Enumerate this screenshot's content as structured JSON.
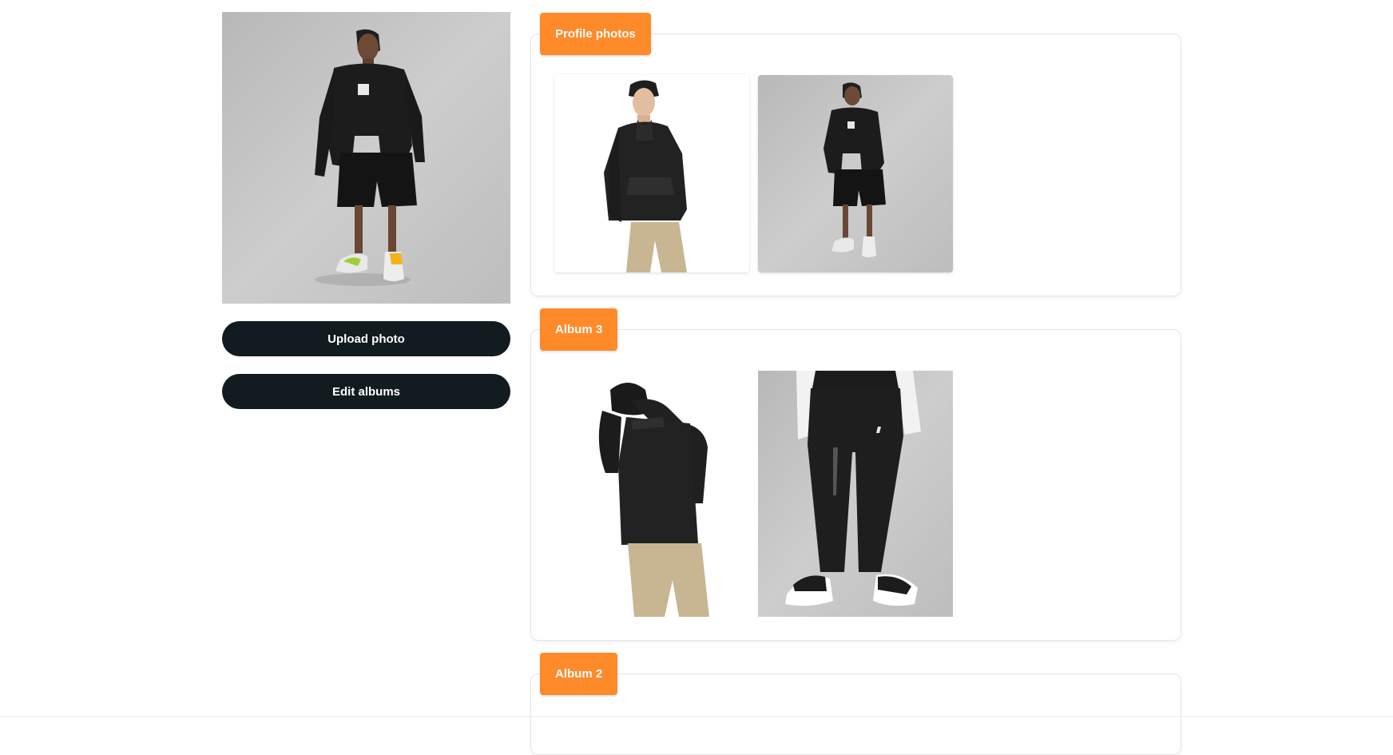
{
  "sidebar": {
    "main_photo": {
      "icon": "man-sweatshirt-shorts-photo"
    },
    "upload_label": "Upload photo",
    "edit_albums_label": "Edit albums"
  },
  "albums": [
    {
      "label": "Profile photos",
      "photos": [
        {
          "icon": "man-hoodie-khaki-photo"
        },
        {
          "icon": "man-sweatshirt-shorts-photo"
        }
      ]
    },
    {
      "label": "Album 3",
      "photos": [
        {
          "icon": "man-pulling-hood-photo"
        },
        {
          "icon": "black-joggers-sneakers-photo"
        }
      ]
    },
    {
      "label": "Album 2",
      "photos": []
    }
  ],
  "colors": {
    "accent": "#ff8a2a",
    "button": "#121b20",
    "photo_background": "#c4c4c4"
  }
}
